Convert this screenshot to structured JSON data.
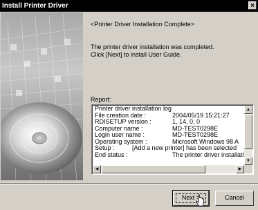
{
  "window": {
    "title": "Install Printer Driver",
    "close_glyph": "×"
  },
  "content": {
    "heading": "<Printer Driver Installation Complete>",
    "message_line1": "The printer driver installation was completed.",
    "message_line2": "Click [Next] to install User Guide.",
    "report_label": "Report:"
  },
  "log": {
    "title": "Printer driver installation log",
    "rows": [
      {
        "key": "File creation date :",
        "value": "2004/05/19 15:21:27"
      },
      {
        "key": "RDISETUP version :",
        "value": "1, 14, 0, 0"
      },
      {
        "key": "Computer name :",
        "value": "MD-TEST0298E"
      },
      {
        "key": "Login user name :",
        "value": "MD-TEST0298E"
      },
      {
        "key": "Operating system :",
        "value": "Microsoft Windows 98  A"
      }
    ],
    "setup_key": "Setup :",
    "setup_value": "[Add a new printer] has been selected",
    "end_key": "End status :",
    "end_value": "The printer driver installation"
  },
  "buttons": {
    "next": "Next >",
    "cancel": "Cancel"
  },
  "icons": [
    "cd-disc-icon",
    "close-icon",
    "arrow-up-icon",
    "arrow-down-icon",
    "arrow-left-icon",
    "arrow-right-icon",
    "mouse-cursor-icon"
  ],
  "colors": {
    "titlebar": "#000000",
    "face": "#d4d0c8",
    "field": "#ffffff"
  }
}
